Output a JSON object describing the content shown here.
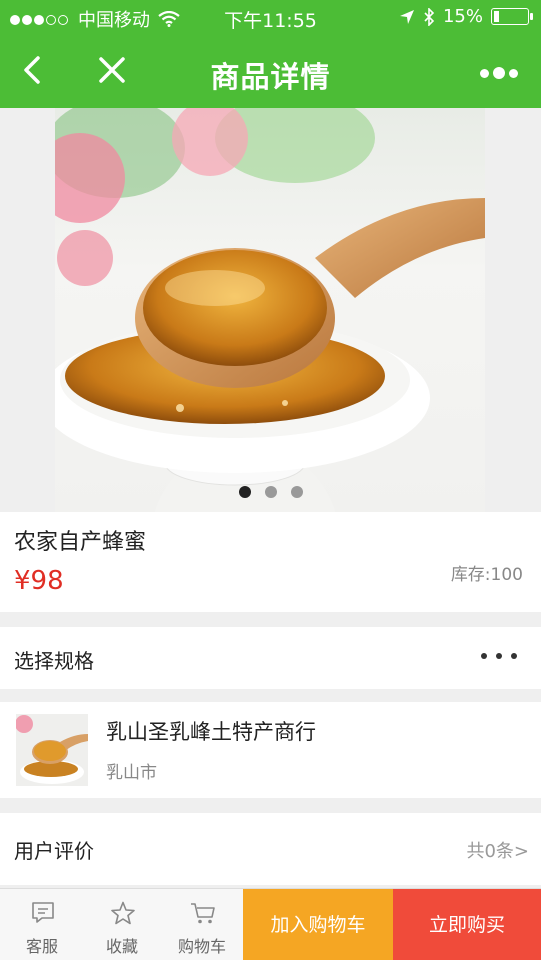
{
  "status_bar": {
    "carrier": "中国移动",
    "time": "下午11:55",
    "battery": "15%",
    "battery_level": 0.15
  },
  "nav": {
    "title": "商品详情"
  },
  "hero": {
    "slide_count": 3,
    "active_slide": 1
  },
  "product": {
    "name": "农家自产蜂蜜",
    "price": "¥98",
    "stock": "库存:100"
  },
  "spec": {
    "label": "选择规格"
  },
  "shop": {
    "name": "乳山圣乳峰土特产商行",
    "city": "乳山市"
  },
  "reviews": {
    "label": "用户评价",
    "count": "共0条>"
  },
  "bottom_bar": {
    "service": "客服",
    "favorite": "收藏",
    "cart": "购物车",
    "add_to_cart": "加入购物车",
    "buy_now": "立即购买"
  },
  "colors": {
    "brand_green": "#4cbd36",
    "price_red": "#e02e24",
    "cart_orange": "#f5a623",
    "buy_red": "#f04b3a"
  },
  "icons": [
    "back-icon",
    "close-icon",
    "more-icon",
    "service-icon",
    "star-icon",
    "cart-icon"
  ]
}
